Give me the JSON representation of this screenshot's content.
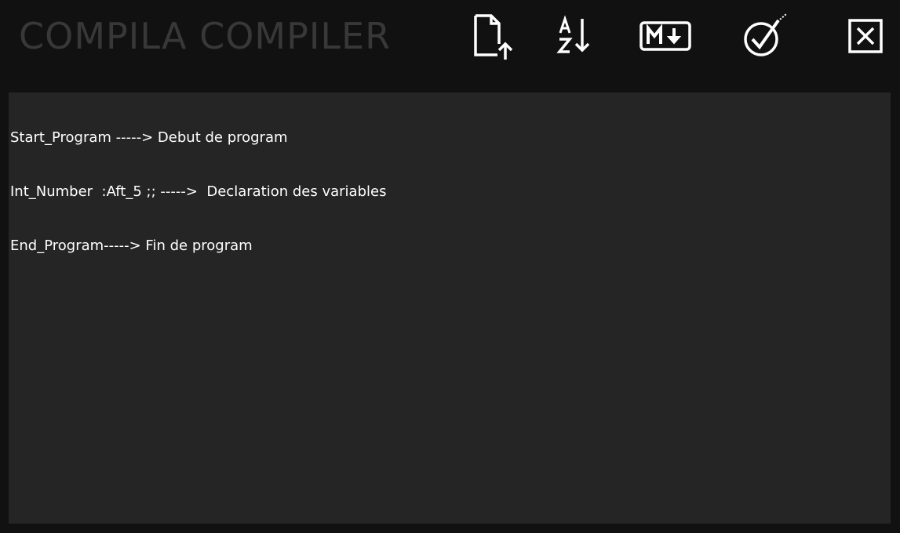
{
  "app": {
    "title": "COMPILA COMPILER"
  },
  "toolbar": {
    "buttons": [
      {
        "icon": "open-file-upload-icon"
      },
      {
        "icon": "sort-alpha-icon"
      },
      {
        "icon": "markdown-download-icon"
      },
      {
        "icon": "check-compile-icon"
      },
      {
        "icon": "close-window-icon"
      }
    ]
  },
  "editor": {
    "lines": [
      "Start_Program -----> Debut de program",
      "Int_Number  :Aft_5 ;; ----->  Declaration des variables",
      "End_Program-----> Fin de program"
    ]
  },
  "colors": {
    "background": "#111111",
    "editor_background": "#252525",
    "title_text": "#383838",
    "editor_text": "#ffffff",
    "icon": "#ffffff"
  }
}
